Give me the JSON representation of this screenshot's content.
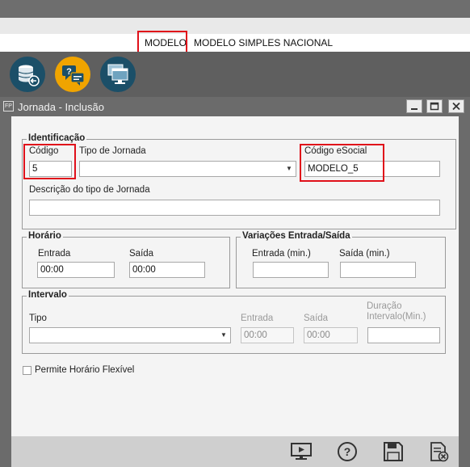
{
  "company": {
    "code": "MODELO",
    "separator": "|",
    "name": "MODELO SIMPLES NACIONAL"
  },
  "toolbar_icons": [
    "database-icon",
    "help-chat-icon",
    "screens-icon"
  ],
  "window": {
    "badge": "FP",
    "title": "Jornada - Inclusão"
  },
  "identificacao": {
    "legend": "Identificação",
    "codigo_label": "Código",
    "codigo_value": "5",
    "tipo_label": "Tipo de Jornada",
    "tipo_value": "",
    "esocial_label": "Código eSocial",
    "esocial_value": "MODELO_5",
    "descricao_label": "Descrição do tipo de Jornada",
    "descricao_value": ""
  },
  "horario": {
    "legend": "Horário",
    "entrada_label": "Entrada",
    "entrada_value": "00:00",
    "saida_label": "Saída",
    "saida_value": "00:00"
  },
  "variacoes": {
    "legend": "Variações Entrada/Saída",
    "entrada_label": "Entrada (min.)",
    "entrada_value": "",
    "saida_label": "Saída (min.)",
    "saida_value": ""
  },
  "intervalo": {
    "legend": "Intervalo",
    "tipo_label": "Tipo",
    "tipo_value": "",
    "entrada_label": "Entrada",
    "entrada_value": "00:00",
    "saida_label": "Saída",
    "saida_value": "00:00",
    "duracao_label_1": "Duração",
    "duracao_label_2": "Intervalo(Min.)",
    "duracao_value": ""
  },
  "flexivel_label": "Permite Horário Flexível",
  "flexivel_checked": false,
  "bottom_icons": [
    "preview-icon",
    "help-icon",
    "save-icon",
    "cancel-icon"
  ],
  "colors": {
    "highlight": "#e0101a",
    "accent_orange": "#f0a400",
    "accent_teal": "#1b4f68"
  }
}
